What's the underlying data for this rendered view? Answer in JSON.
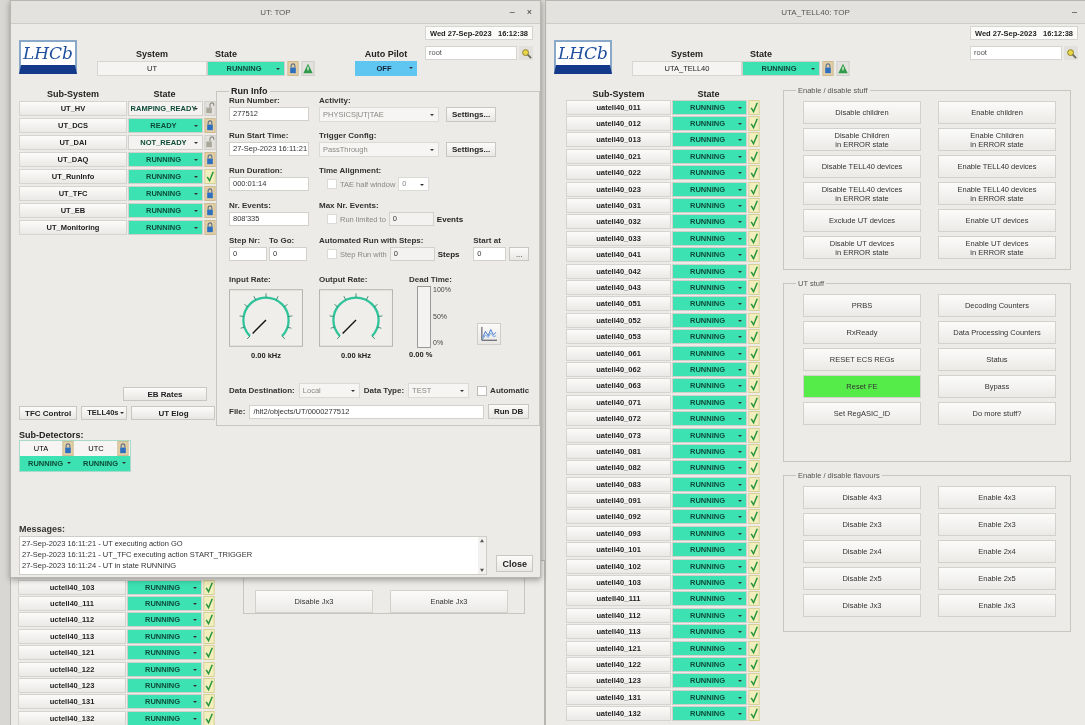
{
  "back_window": {
    "rows": [
      {
        "name": "uctell40_103",
        "state": "RUNNING",
        "color": "#3de2b3",
        "kind": "check"
      },
      {
        "name": "uctell40_111",
        "state": "RUNNING",
        "color": "#3de2b3",
        "kind": "check"
      },
      {
        "name": "uctell40_112",
        "state": "RUNNING",
        "color": "#3de2b3",
        "kind": "check"
      },
      {
        "name": "uctell40_113",
        "state": "RUNNING",
        "color": "#3de2b3",
        "kind": "check"
      },
      {
        "name": "uctell40_121",
        "state": "RUNNING",
        "color": "#3de2b3",
        "kind": "check"
      },
      {
        "name": "uctell40_122",
        "state": "RUNNING",
        "color": "#3de2b3",
        "kind": "check"
      },
      {
        "name": "uctell40_123",
        "state": "RUNNING",
        "color": "#3de2b3",
        "kind": "check"
      },
      {
        "name": "uctell40_131",
        "state": "RUNNING",
        "color": "#3de2b3",
        "kind": "check"
      },
      {
        "name": "uctell40_132",
        "state": "RUNNING",
        "color": "#3de2b3",
        "kind": "check"
      }
    ],
    "buttons": [
      "Disable Jx3",
      "Enable Jx3"
    ]
  },
  "ut_window": {
    "title": "UT: TOP",
    "minimize": "–",
    "close": "×",
    "logo": "LHCb",
    "system_label": "System",
    "system": "UT",
    "state_label": "State",
    "state": {
      "text": "RUNNING",
      "color": "#3de2b3"
    },
    "autopilot_label": "Auto Pilot",
    "autopilot": "OFF",
    "date": "Wed 27-Sep-2023",
    "time": "16:12:38",
    "user": "root",
    "columns": [
      "Sub-System",
      "State"
    ],
    "subsystems": [
      {
        "name": "UT_HV",
        "state": "RAMPING_READY",
        "color": "#f4f3f1",
        "kind": "open-padlock"
      },
      {
        "name": "UT_DCS",
        "state": "READY",
        "color": "#3de2b3",
        "kind": "padlock"
      },
      {
        "name": "UT_DAI",
        "state": "NOT_READY",
        "color": "#f4f3f1",
        "kind": "open-padlock"
      },
      {
        "name": "UT_DAQ",
        "state": "RUNNING",
        "color": "#3de2b3",
        "kind": "padlock"
      },
      {
        "name": "UT_RunInfo",
        "state": "RUNNING",
        "color": "#3de2b3",
        "kind": "check"
      },
      {
        "name": "UT_TFC",
        "state": "RUNNING",
        "color": "#3de2b3",
        "kind": "padlock"
      },
      {
        "name": "UT_EB",
        "state": "RUNNING",
        "color": "#3de2b3",
        "kind": "padlock"
      },
      {
        "name": "UT_Monitoring",
        "state": "RUNNING",
        "color": "#3de2b3",
        "kind": "padlock"
      }
    ],
    "buttons": {
      "eb_rates": "EB Rates",
      "tfc_control": "TFC Control",
      "tell40s": "TELL40s",
      "elog": "UT Elog"
    },
    "subdetectors": {
      "label": "Sub-Detectors:",
      "items": [
        {
          "name": "UTA",
          "state": "RUNNING",
          "color": "#3de2b3"
        },
        {
          "name": "UTC",
          "state": "RUNNING",
          "color": "#3de2b3"
        }
      ]
    },
    "run_info": {
      "title": "Run Info",
      "run_number": {
        "label": "Run Number:",
        "value": "277512"
      },
      "start_time": {
        "label": "Run Start Time:",
        "value": "27-Sep-2023 16:11:21"
      },
      "duration": {
        "label": "Run Duration:",
        "value": "000:01:14"
      },
      "events": {
        "label": "Nr. Events:",
        "value": "808'335"
      },
      "step": {
        "label": "Step Nr:",
        "value": "0"
      },
      "to_go": {
        "label": "To Go:",
        "value": "0"
      },
      "activity": {
        "label": "Activity:",
        "value": "PHYSICS|UT|TAE",
        "disabled": true,
        "button": "Settings..."
      },
      "trigger": {
        "label": "Trigger Config:",
        "value": "PassThrough",
        "disabled": true,
        "button": "Settings..."
      },
      "time_alignment": {
        "label": "Time Alignment:",
        "check": "TAE half window",
        "checked": false,
        "disabled": true,
        "value": "0"
      },
      "max_events": {
        "label": "Max Nr. Events:",
        "check": "Run limited to",
        "checked": false,
        "disabled": true,
        "value": "0",
        "unit": "Events"
      },
      "steps": {
        "label": "Automated Run with Steps:",
        "check": "Step Run with",
        "checked": false,
        "disabled": true,
        "value": "0",
        "unit": "Steps",
        "start_label": "Start at",
        "start": "0",
        "more": "..."
      },
      "input_rate": {
        "label": "Input Rate:",
        "reading": "0.00 kHz"
      },
      "output_rate": {
        "label": "Output Rate:",
        "reading": "0.00 kHz"
      },
      "dead_time": {
        "label": "Dead Time:",
        "ticks": [
          "100%",
          "50%",
          "0%"
        ],
        "level": 0,
        "reading": "0.00 %"
      },
      "destination": {
        "label": "Data Destination:",
        "value": "Local",
        "disabled": true
      },
      "data_type": {
        "label": "Data Type:",
        "value": "TEST",
        "disabled": true
      },
      "automatic": {
        "label": "Automatic",
        "checked": false
      },
      "file": {
        "label": "File:",
        "value": "/hlt2/objects/UT/0000277512"
      },
      "run_db": "Run DB"
    },
    "messages": {
      "label": "Messages:",
      "lines": [
        "27-Sep-2023 16:11:21 - UT executing action GO",
        "27-Sep-2023 16:11:21 - UT_TFC executing action START_TRIGGER",
        "27-Sep-2023 16:11:24 - UT in state RUNNING"
      ],
      "close": "Close"
    }
  },
  "tell40_window": {
    "title": "UTA_TELL40: TOP",
    "minimize": "–",
    "logo": "LHCb",
    "system_label": "System",
    "system": "UTA_TELL40",
    "state_label": "State",
    "state": {
      "text": "RUNNING",
      "color": "#3de2b3"
    },
    "date": "Wed 27-Sep-2023",
    "time": "16:12:38",
    "user": "root",
    "columns": [
      "Sub-System",
      "State"
    ],
    "rows": [
      {
        "name": "uatell40_011",
        "state": "RUNNING",
        "color": "#3de2b3",
        "kind": "check"
      },
      {
        "name": "uatell40_012",
        "state": "RUNNING",
        "color": "#3de2b3",
        "kind": "check"
      },
      {
        "name": "uatell40_013",
        "state": "RUNNING",
        "color": "#3de2b3",
        "kind": "check"
      },
      {
        "name": "uatell40_021",
        "state": "RUNNING",
        "color": "#3de2b3",
        "kind": "check"
      },
      {
        "name": "uatell40_022",
        "state": "RUNNING",
        "color": "#3de2b3",
        "kind": "check"
      },
      {
        "name": "uatell40_023",
        "state": "RUNNING",
        "color": "#3de2b3",
        "kind": "check"
      },
      {
        "name": "uatell40_031",
        "state": "RUNNING",
        "color": "#3de2b3",
        "kind": "check"
      },
      {
        "name": "uatell40_032",
        "state": "RUNNING",
        "color": "#3de2b3",
        "kind": "check"
      },
      {
        "name": "uatell40_033",
        "state": "RUNNING",
        "color": "#3de2b3",
        "kind": "check"
      },
      {
        "name": "uatell40_041",
        "state": "RUNNING",
        "color": "#3de2b3",
        "kind": "check"
      },
      {
        "name": "uatell40_042",
        "state": "RUNNING",
        "color": "#3de2b3",
        "kind": "check"
      },
      {
        "name": "uatell40_043",
        "state": "RUNNING",
        "color": "#3de2b3",
        "kind": "check"
      },
      {
        "name": "uatell40_051",
        "state": "RUNNING",
        "color": "#3de2b3",
        "kind": "check"
      },
      {
        "name": "uatell40_052",
        "state": "RUNNING",
        "color": "#3de2b3",
        "kind": "check"
      },
      {
        "name": "uatell40_053",
        "state": "RUNNING",
        "color": "#3de2b3",
        "kind": "check"
      },
      {
        "name": "uatell40_061",
        "state": "RUNNING",
        "color": "#3de2b3",
        "kind": "check"
      },
      {
        "name": "uatell40_062",
        "state": "RUNNING",
        "color": "#3de2b3",
        "kind": "check"
      },
      {
        "name": "uatell40_063",
        "state": "RUNNING",
        "color": "#3de2b3",
        "kind": "check"
      },
      {
        "name": "uatell40_071",
        "state": "RUNNING",
        "color": "#3de2b3",
        "kind": "check"
      },
      {
        "name": "uatell40_072",
        "state": "RUNNING",
        "color": "#3de2b3",
        "kind": "check"
      },
      {
        "name": "uatell40_073",
        "state": "RUNNING",
        "color": "#3de2b3",
        "kind": "check"
      },
      {
        "name": "uatell40_081",
        "state": "RUNNING",
        "color": "#3de2b3",
        "kind": "check"
      },
      {
        "name": "uatell40_082",
        "state": "RUNNING",
        "color": "#3de2b3",
        "kind": "check"
      },
      {
        "name": "uatell40_083",
        "state": "RUNNING",
        "color": "#3de2b3",
        "kind": "check"
      },
      {
        "name": "uatell40_091",
        "state": "RUNNING",
        "color": "#3de2b3",
        "kind": "check"
      },
      {
        "name": "uatell40_092",
        "state": "RUNNING",
        "color": "#3de2b3",
        "kind": "check"
      },
      {
        "name": "uatell40_093",
        "state": "RUNNING",
        "color": "#3de2b3",
        "kind": "check"
      },
      {
        "name": "uatell40_101",
        "state": "RUNNING",
        "color": "#3de2b3",
        "kind": "check"
      },
      {
        "name": "uatell40_102",
        "state": "RUNNING",
        "color": "#3de2b3",
        "kind": "check"
      },
      {
        "name": "uatell40_103",
        "state": "RUNNING",
        "color": "#3de2b3",
        "kind": "check"
      },
      {
        "name": "uatell40_111",
        "state": "RUNNING",
        "color": "#3de2b3",
        "kind": "check"
      },
      {
        "name": "uatell40_112",
        "state": "RUNNING",
        "color": "#3de2b3",
        "kind": "check"
      },
      {
        "name": "uatell40_113",
        "state": "RUNNING",
        "color": "#3de2b3",
        "kind": "check"
      },
      {
        "name": "uatell40_121",
        "state": "RUNNING",
        "color": "#3de2b3",
        "kind": "check"
      },
      {
        "name": "uatell40_122",
        "state": "RUNNING",
        "color": "#3de2b3",
        "kind": "check"
      },
      {
        "name": "uatell40_123",
        "state": "RUNNING",
        "color": "#3de2b3",
        "kind": "check"
      },
      {
        "name": "uatell40_131",
        "state": "RUNNING",
        "color": "#3de2b3",
        "kind": "check"
      },
      {
        "name": "uatell40_132",
        "state": "RUNNING",
        "color": "#3de2b3",
        "kind": "check"
      }
    ],
    "groups": [
      {
        "title": "Enable / disable stuff",
        "buttons": [
          {
            "label": "Disable children",
            "highlighted": false
          },
          {
            "label": "Enable children",
            "highlighted": false
          },
          {
            "label": "Disable Children\nin ERROR state",
            "highlighted": false
          },
          {
            "label": "Enable Children\nin ERROR state",
            "highlighted": false
          },
          {
            "label": "Disable TELL40 devices",
            "highlighted": false
          },
          {
            "label": "Enable TELL40 devices",
            "highlighted": false
          },
          {
            "label": "Disable TELL40 devices\nin ERROR state",
            "highlighted": false
          },
          {
            "label": "Enable TELL40 devices\nin ERROR state",
            "highlighted": false
          },
          {
            "label": "Exclude UT devices",
            "highlighted": false
          },
          {
            "label": "Enable UT devices",
            "highlighted": false
          },
          {
            "label": "Disable UT devices\nin ERROR state",
            "highlighted": false
          },
          {
            "label": "Enable UT devices\nin ERROR state",
            "highlighted": false
          }
        ]
      },
      {
        "title": "UT stuff",
        "buttons": [
          {
            "label": "PRBS",
            "highlighted": false
          },
          {
            "label": "Decoding Counters",
            "highlighted": false
          },
          {
            "label": "RxReady",
            "highlighted": false
          },
          {
            "label": "Data Processing Counters",
            "highlighted": false
          },
          {
            "label": "RESET ECS REGs",
            "highlighted": false
          },
          {
            "label": "Status",
            "highlighted": false
          },
          {
            "label": "Reset FE",
            "highlighted": true
          },
          {
            "label": "Bypass",
            "highlighted": false
          },
          {
            "label": "Set RegASIC_ID",
            "highlighted": false
          },
          {
            "label": "Do more stuff?",
            "highlighted": false
          }
        ]
      },
      {
        "title": "Enable / disable flavours",
        "buttons": [
          {
            "label": "Disable 4x3",
            "highlighted": false
          },
          {
            "label": "Enable 4x3",
            "highlighted": false
          },
          {
            "label": "Disable 2x3",
            "highlighted": false
          },
          {
            "label": "Enable 2x3",
            "highlighted": false
          },
          {
            "label": "Disable 2x4",
            "highlighted": false
          },
          {
            "label": "Enable 2x4",
            "highlighted": false
          },
          {
            "label": "Disable 2x5",
            "highlighted": false
          },
          {
            "label": "Enable 2x5",
            "highlighted": false
          },
          {
            "label": "Disable Jx3",
            "highlighted": false
          },
          {
            "label": "Enable Jx3",
            "highlighted": false
          }
        ]
      }
    ]
  }
}
